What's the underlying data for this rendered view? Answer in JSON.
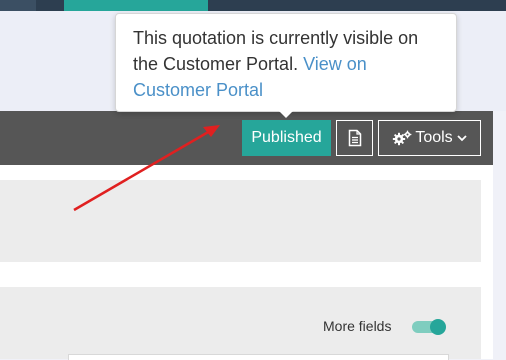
{
  "tooltip": {
    "text": "This quotation is currently visible on the Customer Portal.",
    "link": "View on Customer Portal"
  },
  "toolbar": {
    "published_label": "Published",
    "tools_label": "Tools"
  },
  "more_fields": {
    "label": "More fields",
    "enabled": true
  },
  "colors": {
    "accent": "#26a69a",
    "toolbar_bg": "#565656",
    "link": "#4a90c8",
    "annotation_arrow": "#e02020"
  },
  "icons": {
    "document": "document-icon",
    "tools": "gears-icon",
    "dropdown": "chevron-down-icon"
  }
}
